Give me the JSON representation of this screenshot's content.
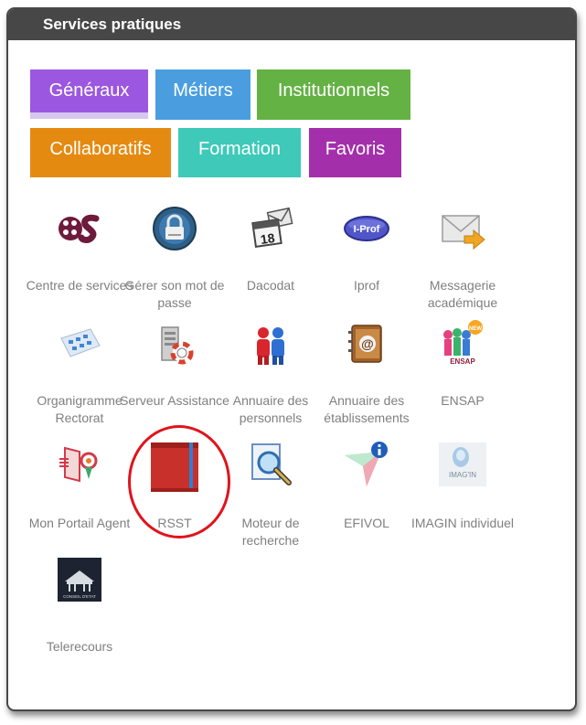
{
  "panel": {
    "title": "Services pratiques"
  },
  "tabs": [
    {
      "label": "Généraux",
      "color": "#9b57e0"
    },
    {
      "label": "Métiers",
      "color": "#4a9ee0"
    },
    {
      "label": "Institutionnels",
      "color": "#64b244"
    },
    {
      "label": "Collaboratifs",
      "color": "#e58a11"
    },
    {
      "label": "Formation",
      "color": "#3ec9b9"
    },
    {
      "label": "Favoris",
      "color": "#a42fab"
    }
  ],
  "tiles": [
    {
      "label": "Centre de services",
      "icon": "cs-logo-icon"
    },
    {
      "label": "Gérer son mot de passe",
      "icon": "lock-icon"
    },
    {
      "label": "Dacodat",
      "icon": "calendar-mail-icon"
    },
    {
      "label": "Iprof",
      "icon": "iprof-icon"
    },
    {
      "label": "Messagerie académique",
      "icon": "envelope-icon"
    },
    {
      "label": "Organigramme Rectorat",
      "icon": "org-chart-icon"
    },
    {
      "label": "Serveur Assistance",
      "icon": "server-lifebuoy-icon"
    },
    {
      "label": "Annuaire des personnels",
      "icon": "people-icon"
    },
    {
      "label": "Annuaire des établissements",
      "icon": "address-book-icon"
    },
    {
      "label": "ENSAP",
      "icon": "ensap-icon"
    },
    {
      "label": "Mon Portail Agent",
      "icon": "portal-icon"
    },
    {
      "label": "RSST",
      "icon": "red-book-icon"
    },
    {
      "label": "Moteur de recherche",
      "icon": "magnifier-icon"
    },
    {
      "label": "EFIVOL",
      "icon": "paper-plane-info-icon"
    },
    {
      "label": "IMAGIN individuel",
      "icon": "imagin-icon"
    },
    {
      "label": "Telerecours",
      "icon": "conseil-etat-icon"
    }
  ],
  "icon_text": {
    "iprof": "I-Prof",
    "cal": "18",
    "ensap": "ENSAP",
    "new": "NEW",
    "imagin": "IMAG'IN",
    "conseil": "CONSEIL D'ETAT"
  },
  "annotation": {
    "highlighted_tile": "RSST",
    "color": "#e0141b"
  }
}
